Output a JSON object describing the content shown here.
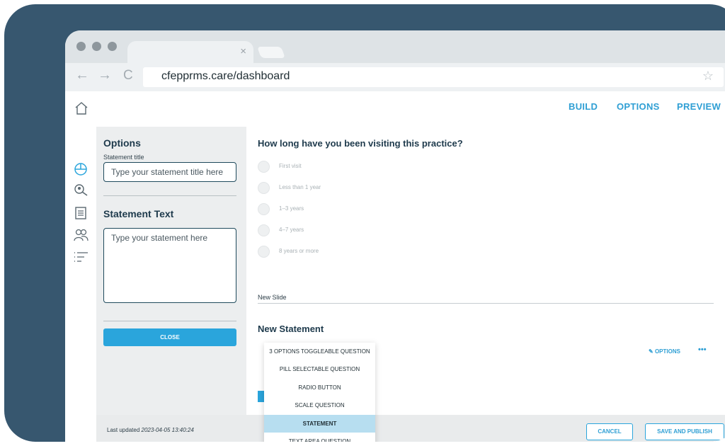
{
  "browser": {
    "url": "cfepprms.care/dashboard",
    "tab_close": "×",
    "back": "←",
    "forward": "→",
    "reload": "C",
    "star": "☆"
  },
  "topnav": {
    "build": "BUILD",
    "options": "OPTIONS",
    "preview": "PREVIEW"
  },
  "sidebar_icons": [
    "home-icon",
    "pie-chart-icon",
    "search-user-icon",
    "document-icon",
    "users-icon",
    "list-filter-icon"
  ],
  "panel": {
    "title": "Options",
    "statement_title_label": "Statement title",
    "statement_title_placeholder": "Type your statement title here",
    "statement_text_heading": "Statement Text",
    "statement_text_placeholder": "Type your statement here",
    "close_label": "CLOSE"
  },
  "question": {
    "title": "How long have you been visiting this practice?",
    "options": [
      "First visit",
      "Less than 1 year",
      "1–3 years",
      "4–7 years",
      "8 years or more"
    ]
  },
  "slide_label": "New Slide",
  "statement_title": "New Statement",
  "statement_actions": {
    "options_label": "OPTIONS",
    "more_label": "•••"
  },
  "dropdown": {
    "items": [
      "3 OPTIONS TOGGLEABLE QUESTION",
      "PILL SELECTABLE QUESTION",
      "RADIO BUTTON",
      "SCALE QUESTION",
      "STATEMENT",
      "TEXT AREA QUESTION"
    ],
    "selected": "STATEMENT"
  },
  "footer": {
    "last_updated_label": "Last updated",
    "last_updated_value": "2023-04-05 13:40:24",
    "cancel_label": "CANCEL",
    "save_label": "SAVE AND PUBLISH"
  },
  "colors": {
    "frame": "#37576f",
    "accent": "#2aa5dc",
    "heading": "#1e3a4c",
    "selected_item": "#b7def0"
  }
}
